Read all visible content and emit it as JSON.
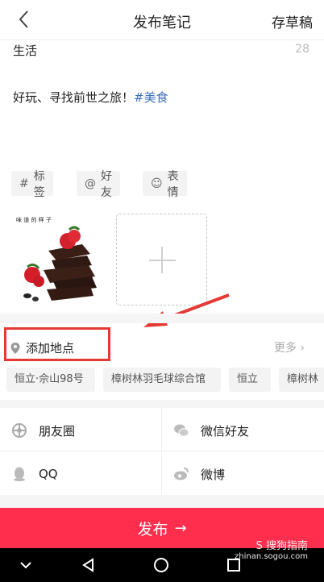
{
  "header": {
    "title": "发布笔记",
    "draft_label": "存草稿"
  },
  "note": {
    "title": "生活",
    "title_counter": "28",
    "body_text": "好玩、寻找前世之旅！",
    "body_hashtag": "#美食"
  },
  "chips": [
    {
      "icon": "hash-icon",
      "glyph": "#",
      "label": "标签"
    },
    {
      "icon": "at-icon",
      "glyph": "@",
      "label": "好友"
    },
    {
      "icon": "smile-icon",
      "glyph": "☺",
      "label": "表情"
    }
  ],
  "photo": {
    "caption": "味 道 的 样 子"
  },
  "location": {
    "label": "添加地点",
    "more_label": "更多 ›",
    "suggestions": [
      "恒立·佘山98号",
      "樟树林羽毛球综合馆",
      "恒立",
      "樟树林"
    ]
  },
  "share": [
    {
      "icon": "moments-icon",
      "label": "朋友圈"
    },
    {
      "icon": "wechat-icon",
      "label": "微信好友"
    },
    {
      "icon": "qq-icon",
      "label": "QQ"
    },
    {
      "icon": "weibo-icon",
      "label": "微博"
    }
  ],
  "publish": {
    "label": "发布",
    "arrow": "→"
  },
  "watermark": {
    "brand": "S 搜狗指南",
    "url": "zhinan.sogou.com"
  },
  "colors": {
    "accent": "#ff2e4d",
    "hashtag": "#3b6fb8",
    "annotation": "#e53935"
  }
}
